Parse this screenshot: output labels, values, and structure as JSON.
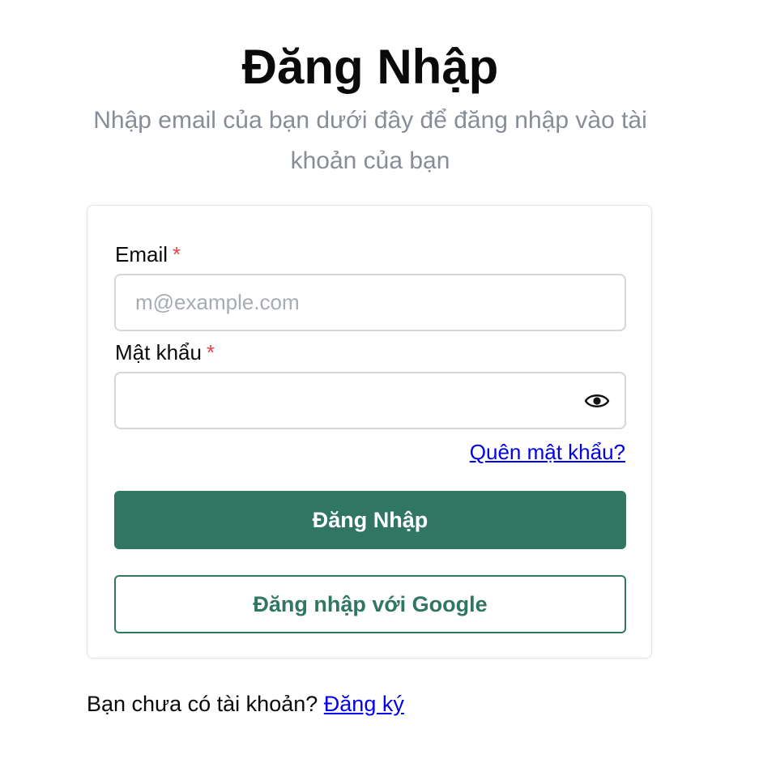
{
  "header": {
    "title": "Đăng Nhập",
    "subtitle": "Nhập email của bạn dưới đây để đăng nhập vào tài khoản của bạn"
  },
  "form": {
    "email_label": "Email",
    "email_required_mark": "*",
    "email_placeholder": "m@example.com",
    "email_value": "",
    "password_label": "Mật khẩu",
    "password_required_mark": "*",
    "password_value": "",
    "forgot_password_link": "Quên mật khẩu?",
    "submit_label": "Đăng Nhập",
    "google_label": "Đăng nhập với Google"
  },
  "footer": {
    "prompt": "Bạn chưa có tài khoản?",
    "signup_link": "Đăng ký"
  },
  "icons": {
    "password_toggle": "eye-icon"
  },
  "colors": {
    "primary": "#317663",
    "link": "#0000ee",
    "required": "#e0444a",
    "muted_text": "#878d96"
  }
}
